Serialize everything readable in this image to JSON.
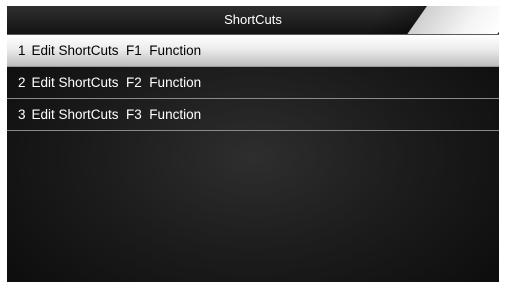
{
  "header": {
    "title": "ShortCuts"
  },
  "menu": {
    "selected_index": 0,
    "items": [
      {
        "number": "1",
        "label": "Edit ShortCuts  F1  Function"
      },
      {
        "number": "2",
        "label": "Edit ShortCuts  F2  Function"
      },
      {
        "number": "3",
        "label": "Edit ShortCuts  F3  Function"
      }
    ]
  },
  "colors": {
    "background": "#111111",
    "selected_row": "#e8e8e8",
    "text": "#ffffff",
    "selected_text": "#000000"
  }
}
